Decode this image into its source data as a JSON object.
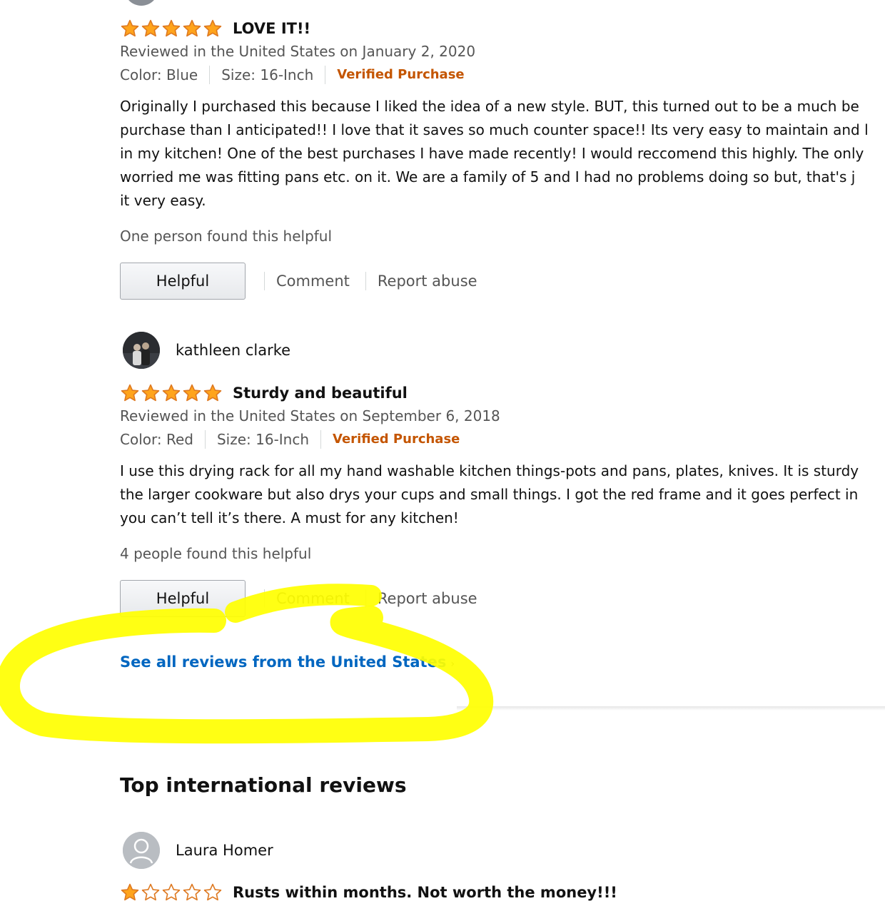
{
  "colors": {
    "star_filled": "#ffa41c",
    "star_outline": "#de7921",
    "verified": "#c45500",
    "link": "#0066c0",
    "annotation_highlight": "#ffff00"
  },
  "reviews": [
    {
      "rating": 5,
      "title": "LOVE IT!!",
      "date_line": "Reviewed in the United States on January 2, 2020",
      "color": "Color: Blue",
      "size": "Size: 16-Inch",
      "verified": "Verified Purchase",
      "body_lines": [
        "Originally I purchased this because I liked the idea of a new style. BUT, this turned out to be a much be",
        "purchase than I anticipated!! I love that it saves so much counter space!! Its very easy to maintain and l",
        "in my kitchen! One of the best purchases I have made recently! I would reccomend this highly. The only",
        "worried me was fitting pans etc. on it. We are a family of 5 and I had no problems doing so but, that's j",
        "it very easy."
      ],
      "helpful_count": "One person found this helpful",
      "helpful_button": "Helpful",
      "comment": "Comment",
      "report": "Report abuse"
    },
    {
      "reviewer": "kathleen clarke",
      "rating": 5,
      "title": "Sturdy and beautiful",
      "date_line": "Reviewed in the United States on September 6, 2018",
      "color": "Color: Red",
      "size": "Size: 16-Inch",
      "verified": "Verified Purchase",
      "body_lines": [
        "I use this drying rack for all my hand washable kitchen things-pots and pans, plates, knives. It is sturdy",
        "the larger cookware but also drys your cups and small things. I got the red frame and it goes perfect in",
        "you can’t tell it’s there. A must for any kitchen!"
      ],
      "helpful_count": "4 people found this helpful",
      "helpful_button": "Helpful",
      "comment": "Comment",
      "report": "Report abuse"
    }
  ],
  "see_all_link": "See all reviews from the United States",
  "see_all_chevron": "›",
  "international": {
    "heading": "Top international reviews",
    "reviewer": "Laura Homer",
    "rating": 1,
    "title": "Rusts within months. Not worth the money!!!"
  }
}
